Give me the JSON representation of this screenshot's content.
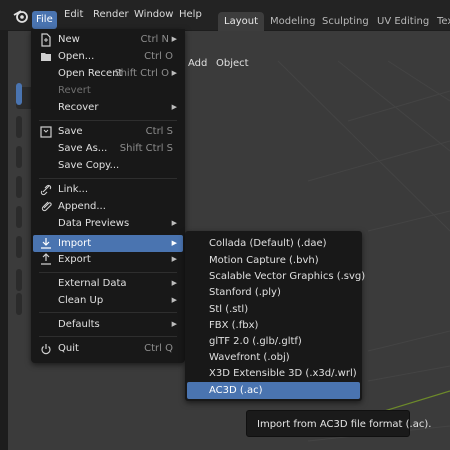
{
  "topbar": {
    "menus": [
      "File",
      "Edit",
      "Render",
      "Window",
      "Help"
    ],
    "workspaces": [
      "Layout",
      "Modeling",
      "Sculpting",
      "UV Editing",
      "Tex"
    ],
    "active_workspace": "Layout"
  },
  "viewport_header": {
    "add_label": "Add",
    "object_label": "Object"
  },
  "file_menu": {
    "items": [
      {
        "icon": "new-file-icon",
        "label": "New",
        "shortcut": "Ctrl N",
        "submenu": true
      },
      {
        "icon": "folder-icon",
        "label": "Open...",
        "shortcut": "Ctrl O"
      },
      {
        "label": "Open Recent",
        "shortcut": "Shift Ctrl O",
        "submenu": true
      },
      {
        "label": "Revert",
        "disabled": true
      },
      {
        "label": "Recover",
        "submenu": true
      },
      {
        "icon": "save-icon",
        "label": "Save",
        "shortcut": "Ctrl S"
      },
      {
        "label": "Save As...",
        "shortcut": "Shift Ctrl S"
      },
      {
        "label": "Save Copy..."
      },
      {
        "icon": "link-icon",
        "label": "Link..."
      },
      {
        "icon": "append-icon",
        "label": "Append..."
      },
      {
        "label": "Data Previews",
        "submenu": true
      },
      {
        "icon": "import-icon",
        "label": "Import",
        "submenu": true,
        "highlighted": true
      },
      {
        "icon": "export-icon",
        "label": "Export",
        "submenu": true
      },
      {
        "label": "External Data",
        "submenu": true
      },
      {
        "label": "Clean Up",
        "submenu": true
      },
      {
        "label": "Defaults",
        "submenu": true
      },
      {
        "icon": "power-icon",
        "label": "Quit",
        "shortcut": "Ctrl Q"
      }
    ]
  },
  "import_submenu": {
    "items": [
      "Collada (Default) (.dae)",
      "Motion Capture (.bvh)",
      "Scalable Vector Graphics (.svg)",
      "Stanford (.ply)",
      "Stl (.stl)",
      "FBX (.fbx)",
      "glTF 2.0 (.glb/.gltf)",
      "Wavefront (.obj)",
      "X3D Extensible 3D (.x3d/.wrl)",
      "AC3D (.ac)"
    ],
    "highlighted": "AC3D (.ac)"
  },
  "tooltip": {
    "text": "Import from AC3D file format (.ac)."
  },
  "colors": {
    "accent": "#4a74b0",
    "menu_bg": "#181818",
    "viewport_bg": "#3b3b3b"
  }
}
